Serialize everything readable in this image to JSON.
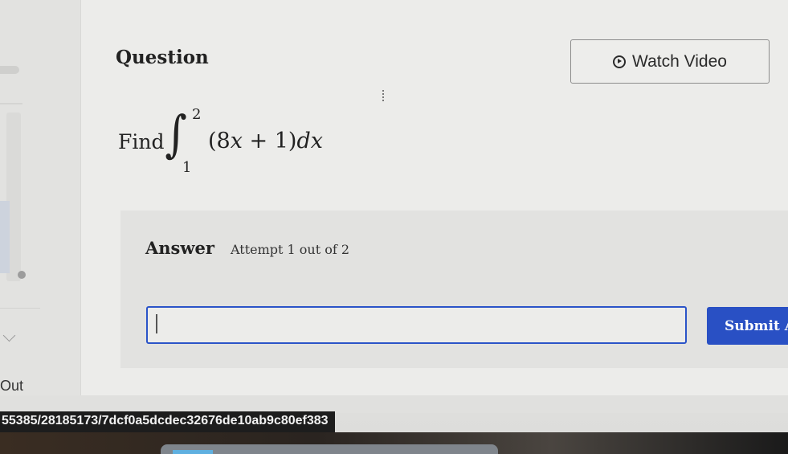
{
  "question": {
    "title": "Question",
    "watch_video_label": "Watch Video",
    "find_label": "Find",
    "integral": {
      "upper_limit": "2",
      "lower_limit": "1",
      "integrand": "(8x + 1)dx"
    }
  },
  "answer": {
    "label": "Answer",
    "attempt_text": "Attempt 1 out of 2",
    "input_value": "",
    "submit_label": "Submit Answer"
  },
  "sidebar": {
    "out_label": "Out"
  },
  "status": {
    "url_text": "55385/28185173/7dcf0a5dcdec32676de10ab9c80ef383"
  },
  "colors": {
    "accent": "#2950c4",
    "input_border": "#2b54c8"
  }
}
